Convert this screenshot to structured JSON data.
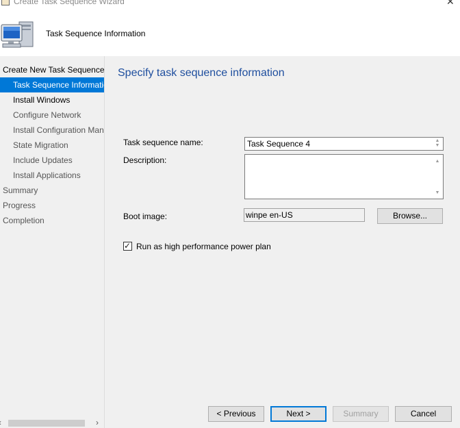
{
  "window": {
    "title": "Create Task Sequence Wizard"
  },
  "header": {
    "title": "Task Sequence Information"
  },
  "nav": {
    "items": [
      {
        "label": "Create New Task Sequence"
      },
      {
        "label": "Task Sequence Information"
      },
      {
        "label": "Install Windows"
      },
      {
        "label": "Configure Network"
      },
      {
        "label": "Install Configuration Manager"
      },
      {
        "label": "State Migration"
      },
      {
        "label": "Include Updates"
      },
      {
        "label": "Install Applications"
      },
      {
        "label": "Summary"
      },
      {
        "label": "Progress"
      },
      {
        "label": "Completion"
      }
    ]
  },
  "page": {
    "heading": "Specify task sequence information",
    "name_label": "Task sequence name:",
    "name_value": "Task Sequence 4",
    "description_label": "Description:",
    "description_value": "",
    "boot_label": "Boot image:",
    "boot_value": "winpe  en-US",
    "browse_label": "Browse...",
    "power_plan_label": "Run as high performance power plan",
    "power_plan_checked": true
  },
  "buttons": {
    "previous": "< Previous",
    "next": "Next >",
    "summary": "Summary",
    "cancel": "Cancel"
  },
  "colors": {
    "accent": "#0078d7",
    "heading": "#1e4e9e",
    "panel": "#f0f0f0"
  }
}
